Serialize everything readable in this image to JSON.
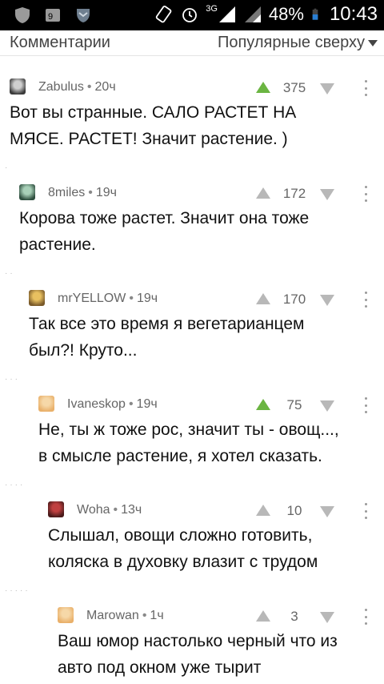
{
  "status_bar": {
    "network": "3G",
    "battery": "48%",
    "time": "10:43"
  },
  "header": {
    "title": "Комментарии",
    "sort_label": "Популярные сверху"
  },
  "comments": [
    {
      "author": "Zabulus",
      "time": "20ч",
      "score": "375",
      "upvoted": true,
      "text": "Вот вы странные. САЛО РАСТЕТ НА\nМЯСЕ. РАСТЕТ! Значит растение. )"
    },
    {
      "author": "8miles",
      "time": "19ч",
      "score": "172",
      "upvoted": false,
      "text": "Корова тоже растет. Значит она тоже\nрастение."
    },
    {
      "author": "mrYELLOW",
      "time": "19ч",
      "score": "170",
      "upvoted": false,
      "text": "Так все это время я вегетарианцем\nбыл?! Круто..."
    },
    {
      "author": "Ivaneskop",
      "time": "19ч",
      "score": "75",
      "upvoted": true,
      "text": "Не, ты ж тоже рос, значит ты - овощ...,\nв смысле растение, я хотел сказать."
    },
    {
      "author": "Woha",
      "time": "13ч",
      "score": "10",
      "upvoted": false,
      "text": "Слышал, овощи сложно готовить,\nколяска в духовку влазит с трудом"
    },
    {
      "author": "Marowan",
      "time": "1ч",
      "score": "3",
      "upvoted": false,
      "text": "Ваш юмор настолько черный что из\nавто под окном уже тырит"
    }
  ],
  "colors": {
    "upvote_active": "#6bb542",
    "vote_inactive": "#b8b8b8",
    "meta_text": "#666666"
  }
}
